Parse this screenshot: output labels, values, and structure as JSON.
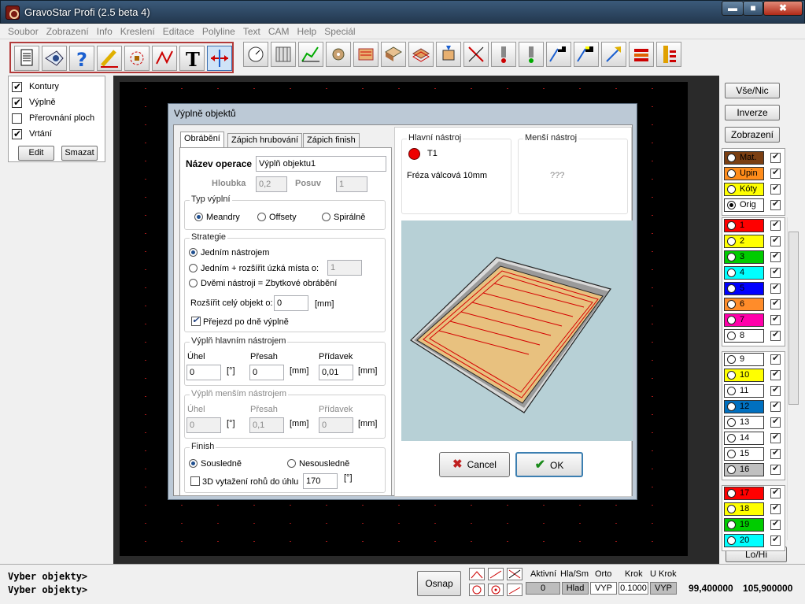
{
  "window": {
    "title": "GravoStar Profi (2.5 beta 4)",
    "minimize": "▬",
    "maximize": "■",
    "close": "✖"
  },
  "menu": [
    "Soubor",
    "Zobrazení",
    "Info",
    "Kreslení",
    "Editace",
    "Polyline",
    "Text",
    "CAM",
    "Help",
    "Speciál"
  ],
  "toolbar_icons": [
    "document-icon",
    "eye-icon",
    "help-icon",
    "pencil-icon",
    "node-edit-icon",
    "polyline-icon",
    "text-icon",
    "move-icon",
    "gauge-icon",
    "hatch-icon",
    "chart-icon",
    "gear-icon",
    "engrave-icon",
    "book-icon",
    "layer-icon",
    "cut-icon",
    "cross-icon",
    "tool-red-icon",
    "tool-green-icon",
    "flag-icon",
    "flag-yellow-icon",
    "arrow-up-icon",
    "stack-icon",
    "bars-icon"
  ],
  "left_panel": {
    "items": [
      {
        "label": "Kontury",
        "checked": true
      },
      {
        "label": "Výplně",
        "checked": true
      },
      {
        "label": "Přerovnání ploch",
        "checked": false
      },
      {
        "label": "Vrtání",
        "checked": true
      }
    ],
    "edit": "Edit",
    "delete": "Smazat"
  },
  "right_panel": {
    "buttons": [
      "Vše/Nic",
      "Inverze",
      "Zobrazení"
    ],
    "special_layers": [
      {
        "label": "Mat.",
        "color": "#7b3f12",
        "selected": false
      },
      {
        "label": "Upin",
        "color": "#ff8c1a",
        "selected": false
      },
      {
        "label": "Kóty",
        "color": "#ffff00",
        "selected": false
      },
      {
        "label": "Orig",
        "color": "#ffffff",
        "selected": true
      }
    ],
    "layers": [
      {
        "label": "1",
        "color": "#ff0000"
      },
      {
        "label": "2",
        "color": "#ffff00"
      },
      {
        "label": "3",
        "color": "#00cc00"
      },
      {
        "label": "4",
        "color": "#00ffff"
      },
      {
        "label": "5",
        "color": "#0000ff"
      },
      {
        "label": "6",
        "color": "#ff8c2a"
      },
      {
        "label": "7",
        "color": "#ff00aa"
      },
      {
        "label": "8",
        "color": "#ffffff"
      },
      {
        "label": "9",
        "color": "#ffffff"
      },
      {
        "label": "10",
        "color": "#ffff00"
      },
      {
        "label": "11",
        "color": "#ffffff"
      },
      {
        "label": "12",
        "color": "#0070c0"
      },
      {
        "label": "13",
        "color": "#ffffff"
      },
      {
        "label": "14",
        "color": "#ffffff"
      },
      {
        "label": "15",
        "color": "#ffffff"
      },
      {
        "label": "16",
        "color": "#c0c0c0"
      },
      {
        "label": "17",
        "color": "#ff0000"
      },
      {
        "label": "18",
        "color": "#ffff00"
      },
      {
        "label": "19",
        "color": "#00cc00"
      },
      {
        "label": "20",
        "color": "#00ffff"
      }
    ],
    "lohi": "Lo/Hi"
  },
  "status": {
    "cmd1": "Vyber objekty>",
    "cmd2": "Vyber objekty>",
    "osnap": "Osnap",
    "labels": {
      "aktivni": "Aktivní",
      "hlasm": "Hla/Sm",
      "orto": "Orto",
      "krok": "Krok",
      "ukrok": "U Krok"
    },
    "values": {
      "aktivni": "0",
      "hlasm": "Hlad",
      "orto": "VYP",
      "krok": "0.1000",
      "ukrok": "VYP"
    },
    "coord_x": "99,400000",
    "coord_y": "105,900000"
  },
  "dialog": {
    "title": "Výplně objektů",
    "tabs": [
      "Obrábění",
      "Zápich hrubování",
      "Zápich finish"
    ],
    "nazev_label": "Název operace",
    "nazev_value": "Výplň objektu1",
    "hloubka_label": "Hloubka",
    "hloubka_value": "0,2",
    "posuv_label": "Posuv",
    "posuv_value": "1",
    "typ_legend": "Typ výplní",
    "typ_options": [
      "Meandry",
      "Offsety",
      "Spirálně"
    ],
    "strategie_legend": "Strategie",
    "strat_1": "Jedním nástrojem",
    "strat_2": "Jedním   + rozšířit úzká místa o:",
    "strat_2_value": "1",
    "strat_3": "Dvěmi nástroji = Zbytkové obrábění",
    "rozsirit_label": "Rozšířit celý objekt o:",
    "rozsirit_value": "0",
    "unit_mm": "[mm]",
    "prejezd": "Přejezd po dně výplně",
    "hlavni_legend": "Výplň hlavním nástrojem",
    "mensi_legend": "Výplň menším nástrojem",
    "uhel": "Úhel",
    "presah": "Přesah",
    "pridavek": "Přídavek",
    "deg": "[°]",
    "h_uhel": "0",
    "h_presah": "0",
    "h_pridavek": "0,01",
    "m_uhel": "0",
    "m_presah": "0,1",
    "m_pridavek": "0",
    "finish_legend": "Finish",
    "finish_1": "Sousledně",
    "finish_2": "Nesousledně",
    "vytazeni": "3D vytažení rohů do úhlu",
    "vytazeni_value": "170",
    "hlavni_nastroj_legend": "Hlavní nástroj",
    "hlavni_nastroj_name": "T1",
    "hlavni_nastroj_desc": "Fréza válcová 10mm",
    "mensi_nastroj_legend": "Menší nástroj",
    "mensi_nastroj_value": "???",
    "cancel": "Cancel",
    "ok": "OK"
  }
}
